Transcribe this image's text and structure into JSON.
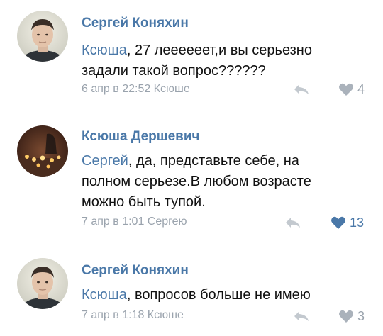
{
  "comments": [
    {
      "author": "Сергей Коняхин",
      "mention": "Ксюша",
      "text_line1_rest": ", 27 леееееет,и вы серьезно",
      "text_line2": "задали такой вопрос??????",
      "meta": "6 апр в 22:52 Ксюше",
      "likes": "4",
      "liked": false,
      "avatar_icon": "person-avatar-icon"
    },
    {
      "author": "Ксюша Дершевич",
      "mention": "Сергей",
      "text_line1_rest": ", да, представьте себе, на",
      "text_line2": "полном серьезе.В любом возрасте",
      "text_line3": "можно быть тупой.",
      "meta": "7 апр в 1:01 Сергею",
      "likes": "13",
      "liked": true,
      "avatar_icon": "candles-avatar-icon"
    },
    {
      "author": "Сергей Коняхин",
      "mention": "Ксюша",
      "text_line1_rest": ", вопросов больше не имею",
      "meta": "7 апр в 1:18 Ксюше",
      "likes": "3",
      "liked": false,
      "avatar_icon": "person-avatar-icon"
    }
  ],
  "colors": {
    "link": "#4a78a8",
    "meta": "#9aa3ad",
    "like_active": "#4a78a8",
    "like_inactive": "#aab2bb",
    "divider": "#e3e5e8"
  },
  "icons": {
    "reply": "reply-arrow-icon",
    "like": "heart-icon"
  }
}
